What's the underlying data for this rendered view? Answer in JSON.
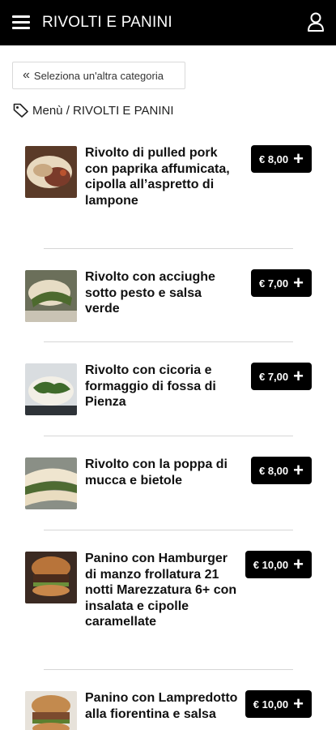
{
  "header": {
    "title": "RIVOLTI E PANINI",
    "menu_icon": "hamburger-menu-icon",
    "user_icon": "user-icon"
  },
  "back_button": {
    "icon": "double-chevron-left-icon",
    "label": "Seleziona un'altra categoria"
  },
  "breadcrumb": {
    "icon": "tag-icon",
    "text": "Menù / RIVOLTI E PANINI"
  },
  "items": [
    {
      "name": "Rivolto di pulled pork con paprika affumicata, cipolla all’aspretto di lampone",
      "price": "€ 8,00"
    },
    {
      "name": "Rivolto con acciughe sotto pesto e salsa verde",
      "price": "€ 7,00"
    },
    {
      "name": "Rivolto con cicoria e formaggio di fossa di Pienza",
      "price": "€ 7,00"
    },
    {
      "name": "Rivolto con la poppa di mucca e bietole",
      "price": "€ 8,00"
    },
    {
      "name": "Panino con Hamburger di manzo frollatura 21 notti Marezzatura 6+ con insalata e cipolle caramellate",
      "price": "€ 10,00"
    },
    {
      "name": "Panino con Lampredotto alla fiorentina e salsa",
      "price": "€ 10,00"
    }
  ],
  "add_icon": "plus-icon",
  "colors": {
    "header_bg": "#000000",
    "button_bg": "#000000",
    "divider": "#d6d6d6"
  }
}
